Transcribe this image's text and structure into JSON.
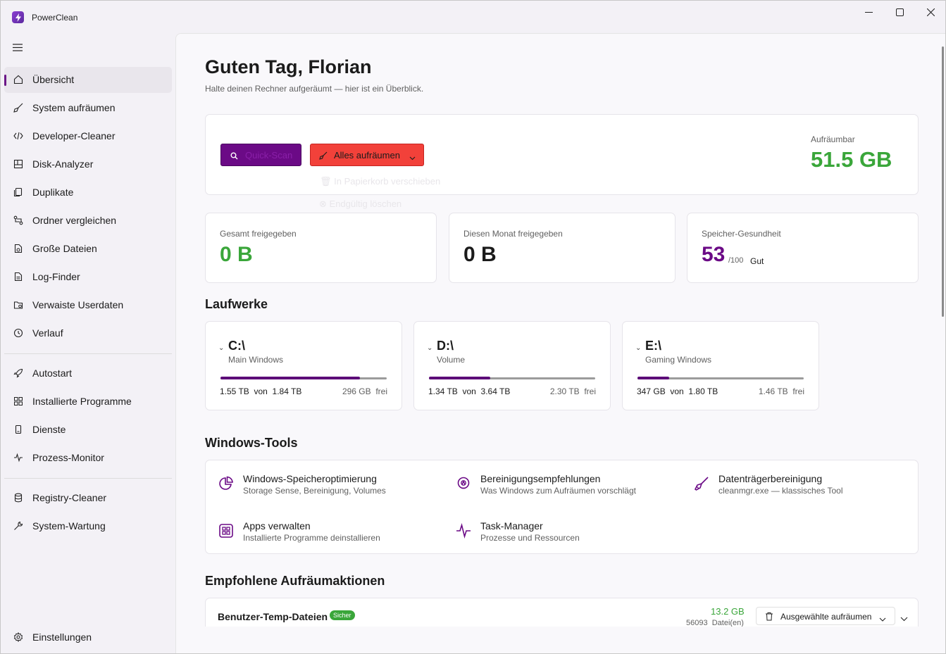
{
  "app": {
    "title": "PowerClean"
  },
  "colors": {
    "accent": "#6b0a86",
    "danger": "#f2413a",
    "success": "#3aa63a",
    "text": "#1b1b1b"
  },
  "sidebar": {
    "items": [
      {
        "label": "Übersicht",
        "icon": "home-icon",
        "active": true
      },
      {
        "label": "System aufräumen",
        "icon": "broom-icon"
      },
      {
        "label": "Developer-Cleaner",
        "icon": "code-icon"
      },
      {
        "label": "Disk-Analyzer",
        "icon": "disk-icon"
      },
      {
        "label": "Duplikate",
        "icon": "duplicate-icon"
      },
      {
        "label": "Ordner vergleichen",
        "icon": "compare-icon"
      },
      {
        "label": "Große Dateien",
        "icon": "large-files-icon"
      },
      {
        "label": "Log-Finder",
        "icon": "document-icon"
      },
      {
        "label": "Verwaiste Userdaten",
        "icon": "folder-icon"
      },
      {
        "label": "Verlauf",
        "icon": "history-icon"
      },
      {
        "label": "Autostart",
        "icon": "rocket-icon"
      },
      {
        "label": "Installierte Programme",
        "icon": "apps-icon"
      },
      {
        "label": "Dienste",
        "icon": "service-icon"
      },
      {
        "label": "Prozess-Monitor",
        "icon": "pulse-icon"
      },
      {
        "label": "Registry-Cleaner",
        "icon": "database-icon"
      },
      {
        "label": "System-Wartung",
        "icon": "wrench-icon"
      }
    ],
    "settings_label": "Einstellungen"
  },
  "header": {
    "greeting": "Guten Tag, Florian",
    "subtitle": "Halte deinen Rechner aufgeräumt — hier ist ein Überblick."
  },
  "actions": {
    "quick_scan_label": "Quick-Scan",
    "clean_all_label": "Alles aufräumen",
    "menu_recycle_label": "In Papierkorb verschieben",
    "menu_delete_label": "Endgültig löschen",
    "cleanable_label": "Aufräumbar",
    "cleanable_value": "51.5 GB"
  },
  "stats": {
    "total_label": "Gesamt freigegeben",
    "total_value": "0 B",
    "month_label": "Diesen Monat freigegeben",
    "month_value": "0 B",
    "health_label": "Speicher-Gesundheit",
    "health_value": "53",
    "health_max": "/100",
    "health_status": "Gut"
  },
  "drives": {
    "title": "Laufwerke",
    "list": [
      {
        "name": "C:\\",
        "volume": "Main Windows",
        "used": "1.55 TB",
        "total": "1.84 TB",
        "free": "296 GB",
        "fill": 0.84
      },
      {
        "name": "D:\\",
        "volume": "Volume",
        "used": "1.34 TB",
        "total": "3.64 TB",
        "free": "2.30 TB",
        "fill": 0.37
      },
      {
        "name": "E:\\",
        "volume": "Gaming Windows",
        "used": "347 GB",
        "total": "1.80 TB",
        "free": "1.46 TB",
        "fill": 0.19
      }
    ],
    "of_label": "von",
    "free_label": "frei"
  },
  "tools": {
    "title": "Windows-Tools",
    "list": [
      {
        "name": "Windows-Speicheroptimierung",
        "desc": "Storage Sense, Bereinigung, Volumes",
        "icon": "pie-chart-icon"
      },
      {
        "name": "Bereinigungsempfehlungen",
        "desc": "Was Windows zum Aufräumen vorschlägt",
        "icon": "lightbulb-icon"
      },
      {
        "name": "Datenträgerbereinigung",
        "desc": "cleanmgr.exe — klassisches Tool",
        "icon": "broom-icon"
      },
      {
        "name": "Apps verwalten",
        "desc": "Installierte Programme deinstallieren",
        "icon": "apps-grid-icon"
      },
      {
        "name": "Task-Manager",
        "desc": "Prozesse und Ressourcen",
        "icon": "pulse-icon"
      }
    ]
  },
  "recommended": {
    "title": "Empfohlene Aufräumaktionen",
    "items": [
      {
        "name": "Benutzer-Temp-Dateien",
        "badge": "Sicher",
        "size": "13.2 GB",
        "count": "56093",
        "count_label": "Datei(en)",
        "action_label": "Ausgewählte aufräumen"
      }
    ]
  }
}
